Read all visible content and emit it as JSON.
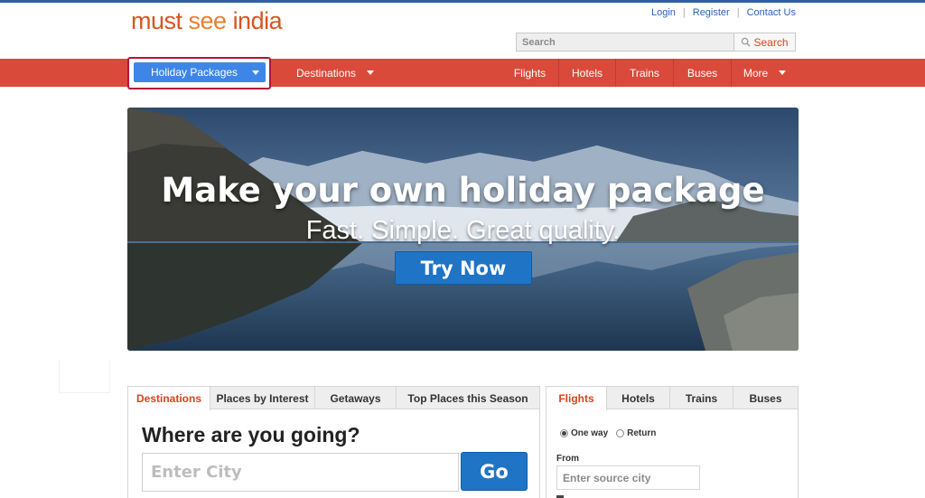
{
  "logo": {
    "part1": "must ",
    "part2": "see ",
    "part3": "india"
  },
  "toplinks": {
    "login": "Login",
    "register": "Register",
    "contact": "Contact Us"
  },
  "search": {
    "placeholder": "Search",
    "button": "Search"
  },
  "nav": {
    "holiday_packages": "Holiday Packages",
    "destinations": "Destinations",
    "right_items": [
      {
        "label": "Flights"
      },
      {
        "label": "Hotels"
      },
      {
        "label": "Trains"
      },
      {
        "label": "Buses"
      },
      {
        "label": "More"
      }
    ]
  },
  "hero": {
    "title": "Make your own holiday package",
    "subtitle": "Fast. Simple. Great quality.",
    "cta": "Try Now"
  },
  "left_panel": {
    "tabs": [
      {
        "label": "Destinations",
        "active": true
      },
      {
        "label": "Places by Interest",
        "active": false
      },
      {
        "label": "Getaways",
        "active": false
      },
      {
        "label": "Top Places this Season",
        "active": false
      }
    ],
    "heading": "Where are you going?",
    "city_placeholder": "Enter City",
    "go_label": "Go"
  },
  "right_panel": {
    "tabs": [
      {
        "label": "Flights",
        "active": true
      },
      {
        "label": "Hotels",
        "active": false
      },
      {
        "label": "Trains",
        "active": false
      },
      {
        "label": "Buses",
        "active": false
      }
    ],
    "trip_type": {
      "one_way": "One way",
      "return": "Return",
      "selected": "One way"
    },
    "from_label": "From",
    "source_placeholder": "Enter source city"
  },
  "colors": {
    "accent": "#d94a3a",
    "brand_orange": "#d9541f",
    "button_blue": "#1f74c6",
    "link_blue": "#2a62b8"
  }
}
